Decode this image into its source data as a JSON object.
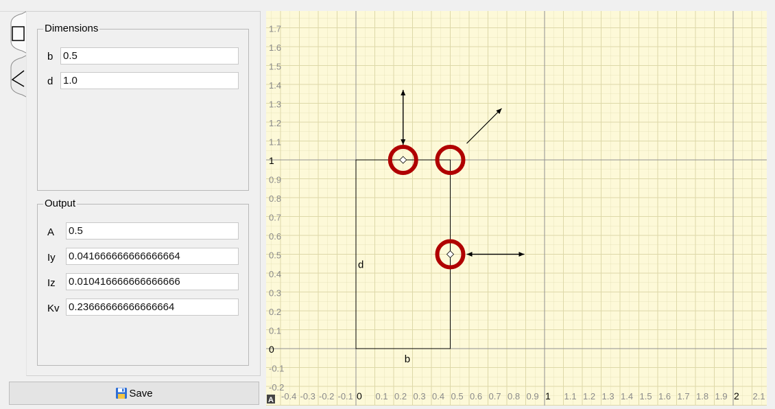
{
  "tabs": [
    {
      "name": "rectangle",
      "icon": "rectangle-icon"
    },
    {
      "name": "triangle",
      "icon": "triangle-icon"
    }
  ],
  "dimensions": {
    "title": "Dimensions",
    "b_label": "b",
    "b_value": "0.5",
    "d_label": "d",
    "d_value": "1.0"
  },
  "output": {
    "title": "Output",
    "A_label": "A",
    "A_value": "0.5",
    "Iy_label": "Iy",
    "Iy_value": "0.041666666666666664",
    "Iz_label": "Iz",
    "Iz_value": "0.010416666666666666",
    "Kv_label": "Kv",
    "Kv_value": "0.23666666666666664"
  },
  "save": {
    "label": "Save",
    "icon": "floppy-disk-icon"
  },
  "plot": {
    "x_ticks": [
      "-0.4",
      "-0.3",
      "-0.2",
      "-0.1",
      "0",
      "0.1",
      "0.2",
      "0.3",
      "0.4",
      "0.5",
      "0.6",
      "0.7",
      "0.8",
      "0.9",
      "1",
      "1.1",
      "1.2",
      "1.3",
      "1.4",
      "1.5",
      "1.6",
      "1.7",
      "1.8",
      "1.9",
      "2",
      "2.1"
    ],
    "y_ticks": [
      "1.7",
      "1.6",
      "1.5",
      "1.4",
      "1.3",
      "1.2",
      "1.1",
      "1",
      "0.9",
      "0.8",
      "0.7",
      "0.6",
      "0.5",
      "0.4",
      "0.3",
      "0.2",
      "0.1",
      "0",
      "-0.1",
      "-0.2"
    ],
    "shape": {
      "b": 0.5,
      "d": 1.0
    },
    "shape_labels": {
      "width": "b",
      "height": "d"
    },
    "corner_badge": "A",
    "colors": {
      "background": "#fdf9d8",
      "grid": "#ddd8a8",
      "axis": "#909090",
      "handle": "#b00000"
    }
  }
}
